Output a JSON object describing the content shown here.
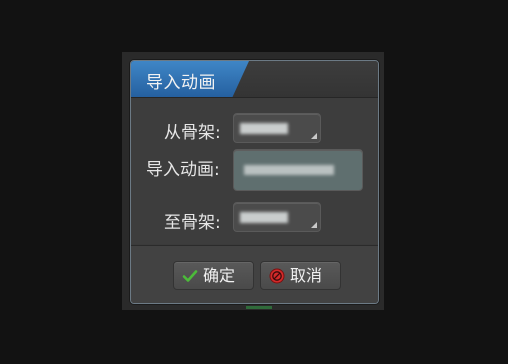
{
  "dialog": {
    "title": "导入动画"
  },
  "form": {
    "from_skeleton_label": "从骨架:",
    "import_animation_label": "导入动画:",
    "to_skeleton_label": "至骨架:"
  },
  "footer": {
    "confirm_label": "确定",
    "cancel_label": "取消"
  },
  "icons": {
    "confirm": "checkmark-icon",
    "cancel": "cancel-icon",
    "dropdown": "dropdown-corner-icon"
  },
  "colors": {
    "title_accent": "#2f72b5",
    "confirm_icon": "#4cbb3a",
    "cancel_icon": "#d22a2a"
  }
}
